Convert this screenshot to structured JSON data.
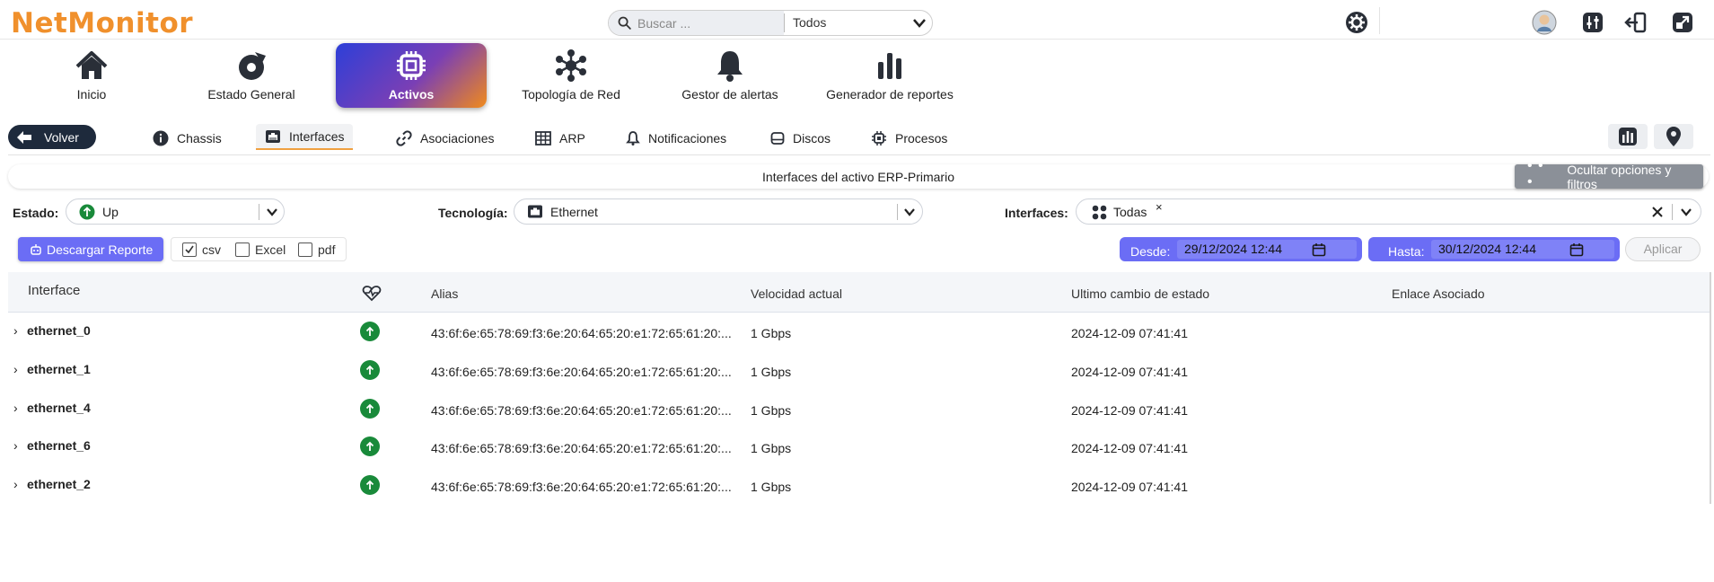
{
  "app": {
    "logo": "NetMonitor"
  },
  "search": {
    "placeholder": "Buscar ...",
    "scope": "Todos"
  },
  "nav": {
    "items": [
      {
        "label": "Inicio",
        "icon": "home-icon"
      },
      {
        "label": "Estado General",
        "icon": "dashboard-icon"
      },
      {
        "label": "Activos",
        "icon": "chip-icon",
        "active": true
      },
      {
        "label": "Topología de Red",
        "icon": "topology-icon"
      },
      {
        "label": "Gestor de alertas",
        "icon": "bell-icon"
      },
      {
        "label": "Generador de reportes",
        "icon": "bar-chart-icon"
      }
    ]
  },
  "subnav": {
    "back_label": "Volver",
    "tabs": [
      {
        "label": "Chassis",
        "icon": "info-icon"
      },
      {
        "label": "Interfaces",
        "icon": "network-port-icon",
        "active": true
      },
      {
        "label": "Asociaciones",
        "icon": "link-icon"
      },
      {
        "label": "ARP",
        "icon": "table-icon"
      },
      {
        "label": "Notificaciones",
        "icon": "bell-icon"
      },
      {
        "label": "Discos",
        "icon": "disk-icon"
      },
      {
        "label": "Procesos",
        "icon": "cpu-icon"
      }
    ]
  },
  "panel": {
    "title": "Interfaces del activo ERP-Primario",
    "hide_options_label": "Ocultar opciones y filtros"
  },
  "filters": {
    "estado_label": "Estado:",
    "estado_value": "Up",
    "tecnologia_label": "Tecnología:",
    "tecnologia_value": "Ethernet",
    "interfaces_label": "Interfaces:",
    "interfaces_value": "Todas",
    "interfaces_chip_close": "×"
  },
  "report": {
    "download_label": "Descargar Reporte",
    "formats": [
      {
        "label": "csv",
        "checked": true
      },
      {
        "label": "Excel",
        "checked": false
      },
      {
        "label": "pdf",
        "checked": false
      }
    ],
    "desde_label": "Desde:",
    "desde_value": "29/12/2024 12:44",
    "hasta_label": "Hasta:",
    "hasta_value": "30/12/2024 12:44",
    "apply_label": "Aplicar"
  },
  "table": {
    "headers": {
      "interface": "Interface",
      "alias": "Alias",
      "speed": "Velocidad actual",
      "last_change": "Ultimo cambio de estado",
      "link": "Enlace Asociado"
    },
    "rows": [
      {
        "name": "ethernet_0",
        "status": "up",
        "alias": "43:6f:6e:65:78:69:f3:6e:20:64:65:20:e1:72:65:61:20:...",
        "speed": "1 Gbps",
        "last_change": "2024-12-09 07:41:41",
        "link": ""
      },
      {
        "name": "ethernet_1",
        "status": "up",
        "alias": "43:6f:6e:65:78:69:f3:6e:20:64:65:20:e1:72:65:61:20:...",
        "speed": "1 Gbps",
        "last_change": "2024-12-09 07:41:41",
        "link": ""
      },
      {
        "name": "ethernet_4",
        "status": "up",
        "alias": "43:6f:6e:65:78:69:f3:6e:20:64:65:20:e1:72:65:61:20:...",
        "speed": "1 Gbps",
        "last_change": "2024-12-09 07:41:41",
        "link": ""
      },
      {
        "name": "ethernet_6",
        "status": "up",
        "alias": "43:6f:6e:65:78:69:f3:6e:20:64:65:20:e1:72:65:61:20:...",
        "speed": "1 Gbps",
        "last_change": "2024-12-09 07:41:41",
        "link": ""
      },
      {
        "name": "ethernet_2",
        "status": "up",
        "alias": "43:6f:6e:65:78:69:f3:6e:20:64:65:20:e1:72:65:61:20:...",
        "speed": "1 Gbps",
        "last_change": "2024-12-09 07:41:41",
        "link": ""
      }
    ]
  },
  "colors": {
    "brand": "#f0902c",
    "accent": "#6b6df5",
    "status_up": "#198a3a",
    "dark_button": "#1e2a3c"
  }
}
